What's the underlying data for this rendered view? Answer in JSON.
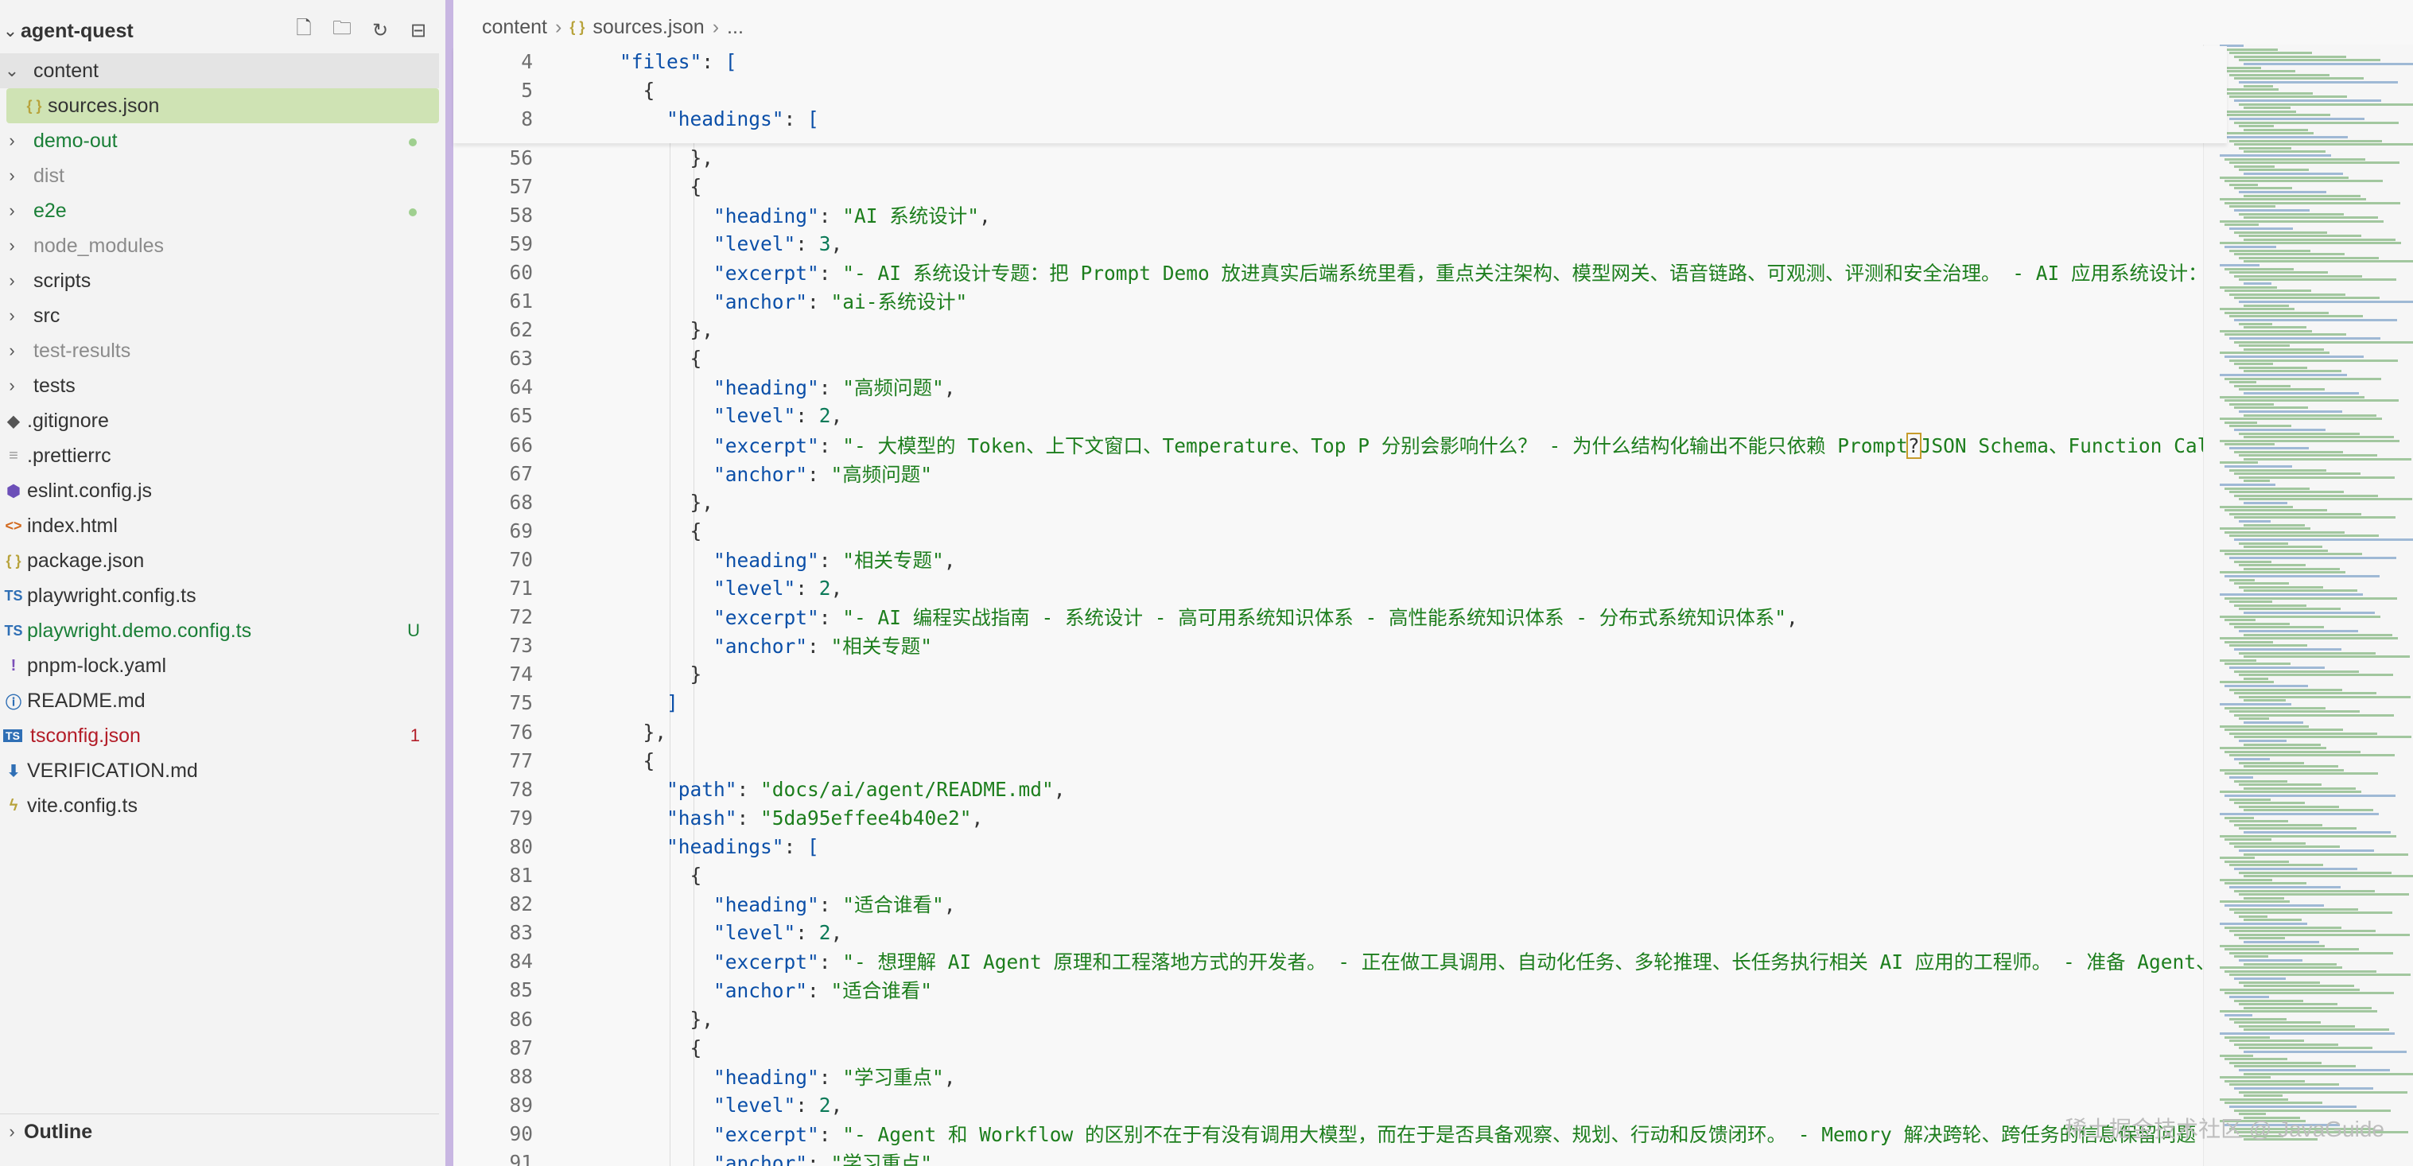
{
  "sidebar": {
    "title": "agent-quest",
    "actions": [
      {
        "name": "new-file-icon",
        "glyph": "🗋"
      },
      {
        "name": "new-folder-icon",
        "glyph": "🗀"
      },
      {
        "name": "refresh-icon",
        "glyph": "↻"
      },
      {
        "name": "collapse-all-icon",
        "glyph": "⊟"
      }
    ],
    "items": [
      {
        "label": "content",
        "type": "folder-open",
        "color": "normal"
      },
      {
        "label": "sources.json",
        "type": "json",
        "color": "normal",
        "indent": 1,
        "selected": true
      },
      {
        "label": "demo-out",
        "type": "folder",
        "color": "green",
        "badge": "dot"
      },
      {
        "label": "dist",
        "type": "folder",
        "color": "gray"
      },
      {
        "label": "e2e",
        "type": "folder",
        "color": "green",
        "badge": "dot"
      },
      {
        "label": "node_modules",
        "type": "folder",
        "color": "gray"
      },
      {
        "label": "scripts",
        "type": "folder",
        "color": "normal"
      },
      {
        "label": "src",
        "type": "folder",
        "color": "normal"
      },
      {
        "label": "test-results",
        "type": "folder",
        "color": "gray"
      },
      {
        "label": "tests",
        "type": "folder",
        "color": "normal"
      },
      {
        "label": ".gitignore",
        "type": "git",
        "color": "normal"
      },
      {
        "label": ".prettierrc",
        "type": "text",
        "color": "normal"
      },
      {
        "label": "eslint.config.js",
        "type": "eslint",
        "color": "normal"
      },
      {
        "label": "index.html",
        "type": "html",
        "color": "normal"
      },
      {
        "label": "package.json",
        "type": "json",
        "color": "normal"
      },
      {
        "label": "playwright.config.ts",
        "type": "ts",
        "color": "normal"
      },
      {
        "label": "playwright.demo.config.ts",
        "type": "ts",
        "color": "green",
        "badge": "U"
      },
      {
        "label": "pnpm-lock.yaml",
        "type": "yaml",
        "color": "normal"
      },
      {
        "label": "README.md",
        "type": "info",
        "color": "normal"
      },
      {
        "label": "tsconfig.json",
        "type": "tsjson",
        "color": "red",
        "badge": "1"
      },
      {
        "label": "VERIFICATION.md",
        "type": "md",
        "color": "normal"
      },
      {
        "label": "vite.config.ts",
        "type": "vite",
        "color": "normal"
      }
    ],
    "outline_label": "Outline"
  },
  "breadcrumb": [
    "content",
    "sources.json",
    "..."
  ],
  "sticky_lines": [
    {
      "ln": "4",
      "indent": 2,
      "tokens": [
        [
          "k",
          "\"files\""
        ],
        [
          "p",
          ": "
        ],
        [
          "br",
          "["
        ]
      ]
    },
    {
      "ln": "5",
      "indent": 3,
      "tokens": [
        [
          "p",
          "{"
        ]
      ]
    },
    {
      "ln": "8",
      "indent": 4,
      "tokens": [
        [
          "k",
          "\"headings\""
        ],
        [
          "p",
          ": "
        ],
        [
          "br",
          "["
        ]
      ]
    }
  ],
  "code_lines": [
    {
      "ln": "56",
      "indent": 5,
      "tokens": [
        [
          "p",
          "},"
        ]
      ]
    },
    {
      "ln": "57",
      "indent": 5,
      "tokens": [
        [
          "p",
          "{"
        ]
      ]
    },
    {
      "ln": "58",
      "indent": 6,
      "tokens": [
        [
          "k",
          "\"heading\""
        ],
        [
          "p",
          ": "
        ],
        [
          "s",
          "\"AI 系统设计\""
        ],
        [
          "p",
          ","
        ]
      ]
    },
    {
      "ln": "59",
      "indent": 6,
      "tokens": [
        [
          "k",
          "\"level\""
        ],
        [
          "p",
          ": "
        ],
        [
          "n",
          "3"
        ],
        [
          "p",
          ","
        ]
      ]
    },
    {
      "ln": "60",
      "indent": 6,
      "tokens": [
        [
          "k",
          "\"excerpt\""
        ],
        [
          "p",
          ": "
        ],
        [
          "s",
          "\"- AI 系统设计专题：把 Prompt Demo 放进真实后端系统里看，重点关注架构、模型网关、语音链路、可观测、评测和安全治理。 - AI 应用系统设计：把 Prom"
        ]
      ]
    },
    {
      "ln": "61",
      "indent": 6,
      "tokens": [
        [
          "k",
          "\"anchor\""
        ],
        [
          "p",
          ": "
        ],
        [
          "s",
          "\"ai-系统设计\""
        ]
      ]
    },
    {
      "ln": "62",
      "indent": 5,
      "tokens": [
        [
          "p",
          "},"
        ]
      ]
    },
    {
      "ln": "63",
      "indent": 5,
      "tokens": [
        [
          "p",
          "{"
        ]
      ]
    },
    {
      "ln": "64",
      "indent": 6,
      "tokens": [
        [
          "k",
          "\"heading\""
        ],
        [
          "p",
          ": "
        ],
        [
          "s",
          "\"高频问题\""
        ],
        [
          "p",
          ","
        ]
      ]
    },
    {
      "ln": "65",
      "indent": 6,
      "tokens": [
        [
          "k",
          "\"level\""
        ],
        [
          "p",
          ": "
        ],
        [
          "n",
          "2"
        ],
        [
          "p",
          ","
        ]
      ]
    },
    {
      "ln": "66",
      "indent": 6,
      "tokens": [
        [
          "k",
          "\"excerpt\""
        ],
        [
          "p",
          ": "
        ],
        [
          "s",
          "\"- 大模型的 Token、上下文窗口、Temperature、Top P 分别会影响什么？ - 为什么结构化输出不能只依赖 Prompt"
        ],
        [
          "cur",
          "?"
        ],
        [
          "s",
          "JSON Schema、Function Calling 和"
        ]
      ]
    },
    {
      "ln": "67",
      "indent": 6,
      "tokens": [
        [
          "k",
          "\"anchor\""
        ],
        [
          "p",
          ": "
        ],
        [
          "s",
          "\"高频问题\""
        ]
      ]
    },
    {
      "ln": "68",
      "indent": 5,
      "tokens": [
        [
          "p",
          "},"
        ]
      ]
    },
    {
      "ln": "69",
      "indent": 5,
      "tokens": [
        [
          "p",
          "{"
        ]
      ]
    },
    {
      "ln": "70",
      "indent": 6,
      "tokens": [
        [
          "k",
          "\"heading\""
        ],
        [
          "p",
          ": "
        ],
        [
          "s",
          "\"相关专题\""
        ],
        [
          "p",
          ","
        ]
      ]
    },
    {
      "ln": "71",
      "indent": 6,
      "tokens": [
        [
          "k",
          "\"level\""
        ],
        [
          "p",
          ": "
        ],
        [
          "n",
          "2"
        ],
        [
          "p",
          ","
        ]
      ]
    },
    {
      "ln": "72",
      "indent": 6,
      "tokens": [
        [
          "k",
          "\"excerpt\""
        ],
        [
          "p",
          ": "
        ],
        [
          "s",
          "\"- AI 编程实战指南 - 系统设计 - 高可用系统知识体系 - 高性能系统知识体系 - 分布式系统知识体系\""
        ],
        [
          "p",
          ","
        ]
      ]
    },
    {
      "ln": "73",
      "indent": 6,
      "tokens": [
        [
          "k",
          "\"anchor\""
        ],
        [
          "p",
          ": "
        ],
        [
          "s",
          "\"相关专题\""
        ]
      ]
    },
    {
      "ln": "74",
      "indent": 5,
      "tokens": [
        [
          "p",
          "}"
        ]
      ]
    },
    {
      "ln": "75",
      "indent": 4,
      "tokens": [
        [
          "br",
          "]"
        ]
      ]
    },
    {
      "ln": "76",
      "indent": 3,
      "tokens": [
        [
          "p",
          "},"
        ]
      ]
    },
    {
      "ln": "77",
      "indent": 3,
      "tokens": [
        [
          "p",
          "{"
        ]
      ]
    },
    {
      "ln": "78",
      "indent": 4,
      "tokens": [
        [
          "k",
          "\"path\""
        ],
        [
          "p",
          ": "
        ],
        [
          "s",
          "\"docs/ai/agent/README.md\""
        ],
        [
          "p",
          ","
        ]
      ]
    },
    {
      "ln": "79",
      "indent": 4,
      "tokens": [
        [
          "k",
          "\"hash\""
        ],
        [
          "p",
          ": "
        ],
        [
          "s",
          "\"5da95effee4b40e2\""
        ],
        [
          "p",
          ","
        ]
      ]
    },
    {
      "ln": "80",
      "indent": 4,
      "tokens": [
        [
          "k",
          "\"headings\""
        ],
        [
          "p",
          ": "
        ],
        [
          "br",
          "["
        ]
      ]
    },
    {
      "ln": "81",
      "indent": 5,
      "tokens": [
        [
          "p",
          "{"
        ]
      ]
    },
    {
      "ln": "82",
      "indent": 6,
      "tokens": [
        [
          "k",
          "\"heading\""
        ],
        [
          "p",
          ": "
        ],
        [
          "s",
          "\"适合谁看\""
        ],
        [
          "p",
          ","
        ]
      ]
    },
    {
      "ln": "83",
      "indent": 6,
      "tokens": [
        [
          "k",
          "\"level\""
        ],
        [
          "p",
          ": "
        ],
        [
          "n",
          "2"
        ],
        [
          "p",
          ","
        ]
      ]
    },
    {
      "ln": "84",
      "indent": 6,
      "tokens": [
        [
          "k",
          "\"excerpt\""
        ],
        [
          "p",
          ": "
        ],
        [
          "s",
          "\"- 想理解 AI Agent 原理和工程落地方式的开发者。 - 正在做工具调用、自动化任务、多轮推理、长任务执行相关 AI 应用的工程师。 - 准备 Agent、MCP、P"
        ]
      ]
    },
    {
      "ln": "85",
      "indent": 6,
      "tokens": [
        [
          "k",
          "\"anchor\""
        ],
        [
          "p",
          ": "
        ],
        [
          "s",
          "\"适合谁看\""
        ]
      ]
    },
    {
      "ln": "86",
      "indent": 5,
      "tokens": [
        [
          "p",
          "},"
        ]
      ]
    },
    {
      "ln": "87",
      "indent": 5,
      "tokens": [
        [
          "p",
          "{"
        ]
      ]
    },
    {
      "ln": "88",
      "indent": 6,
      "tokens": [
        [
          "k",
          "\"heading\""
        ],
        [
          "p",
          ": "
        ],
        [
          "s",
          "\"学习重点\""
        ],
        [
          "p",
          ","
        ]
      ]
    },
    {
      "ln": "89",
      "indent": 6,
      "tokens": [
        [
          "k",
          "\"level\""
        ],
        [
          "p",
          ": "
        ],
        [
          "n",
          "2"
        ],
        [
          "p",
          ","
        ]
      ]
    },
    {
      "ln": "90",
      "indent": 6,
      "tokens": [
        [
          "k",
          "\"excerpt\""
        ],
        [
          "p",
          ": "
        ],
        [
          "s",
          "\"- Agent 和 Workflow 的区别不在于有没有调用大模型，而在于是否具备观察、规划、行动和反馈闭环。 - Memory 解决跨轮、跨任务的信息保留问题"
        ]
      ]
    },
    {
      "ln": "91",
      "indent": 6,
      "tokens": [
        [
          "k",
          "\"anchor\""
        ],
        [
          "p",
          ": "
        ],
        [
          "s",
          "\"学习重点\""
        ]
      ]
    }
  ],
  "watermark": "稀土掘金技术社区 @ JavaGuide",
  "colors": {
    "selected_bg": "#cfe3b4",
    "sash": "#c8b6e2",
    "string": "#1d7e1d",
    "key": "#0b4fa8"
  }
}
